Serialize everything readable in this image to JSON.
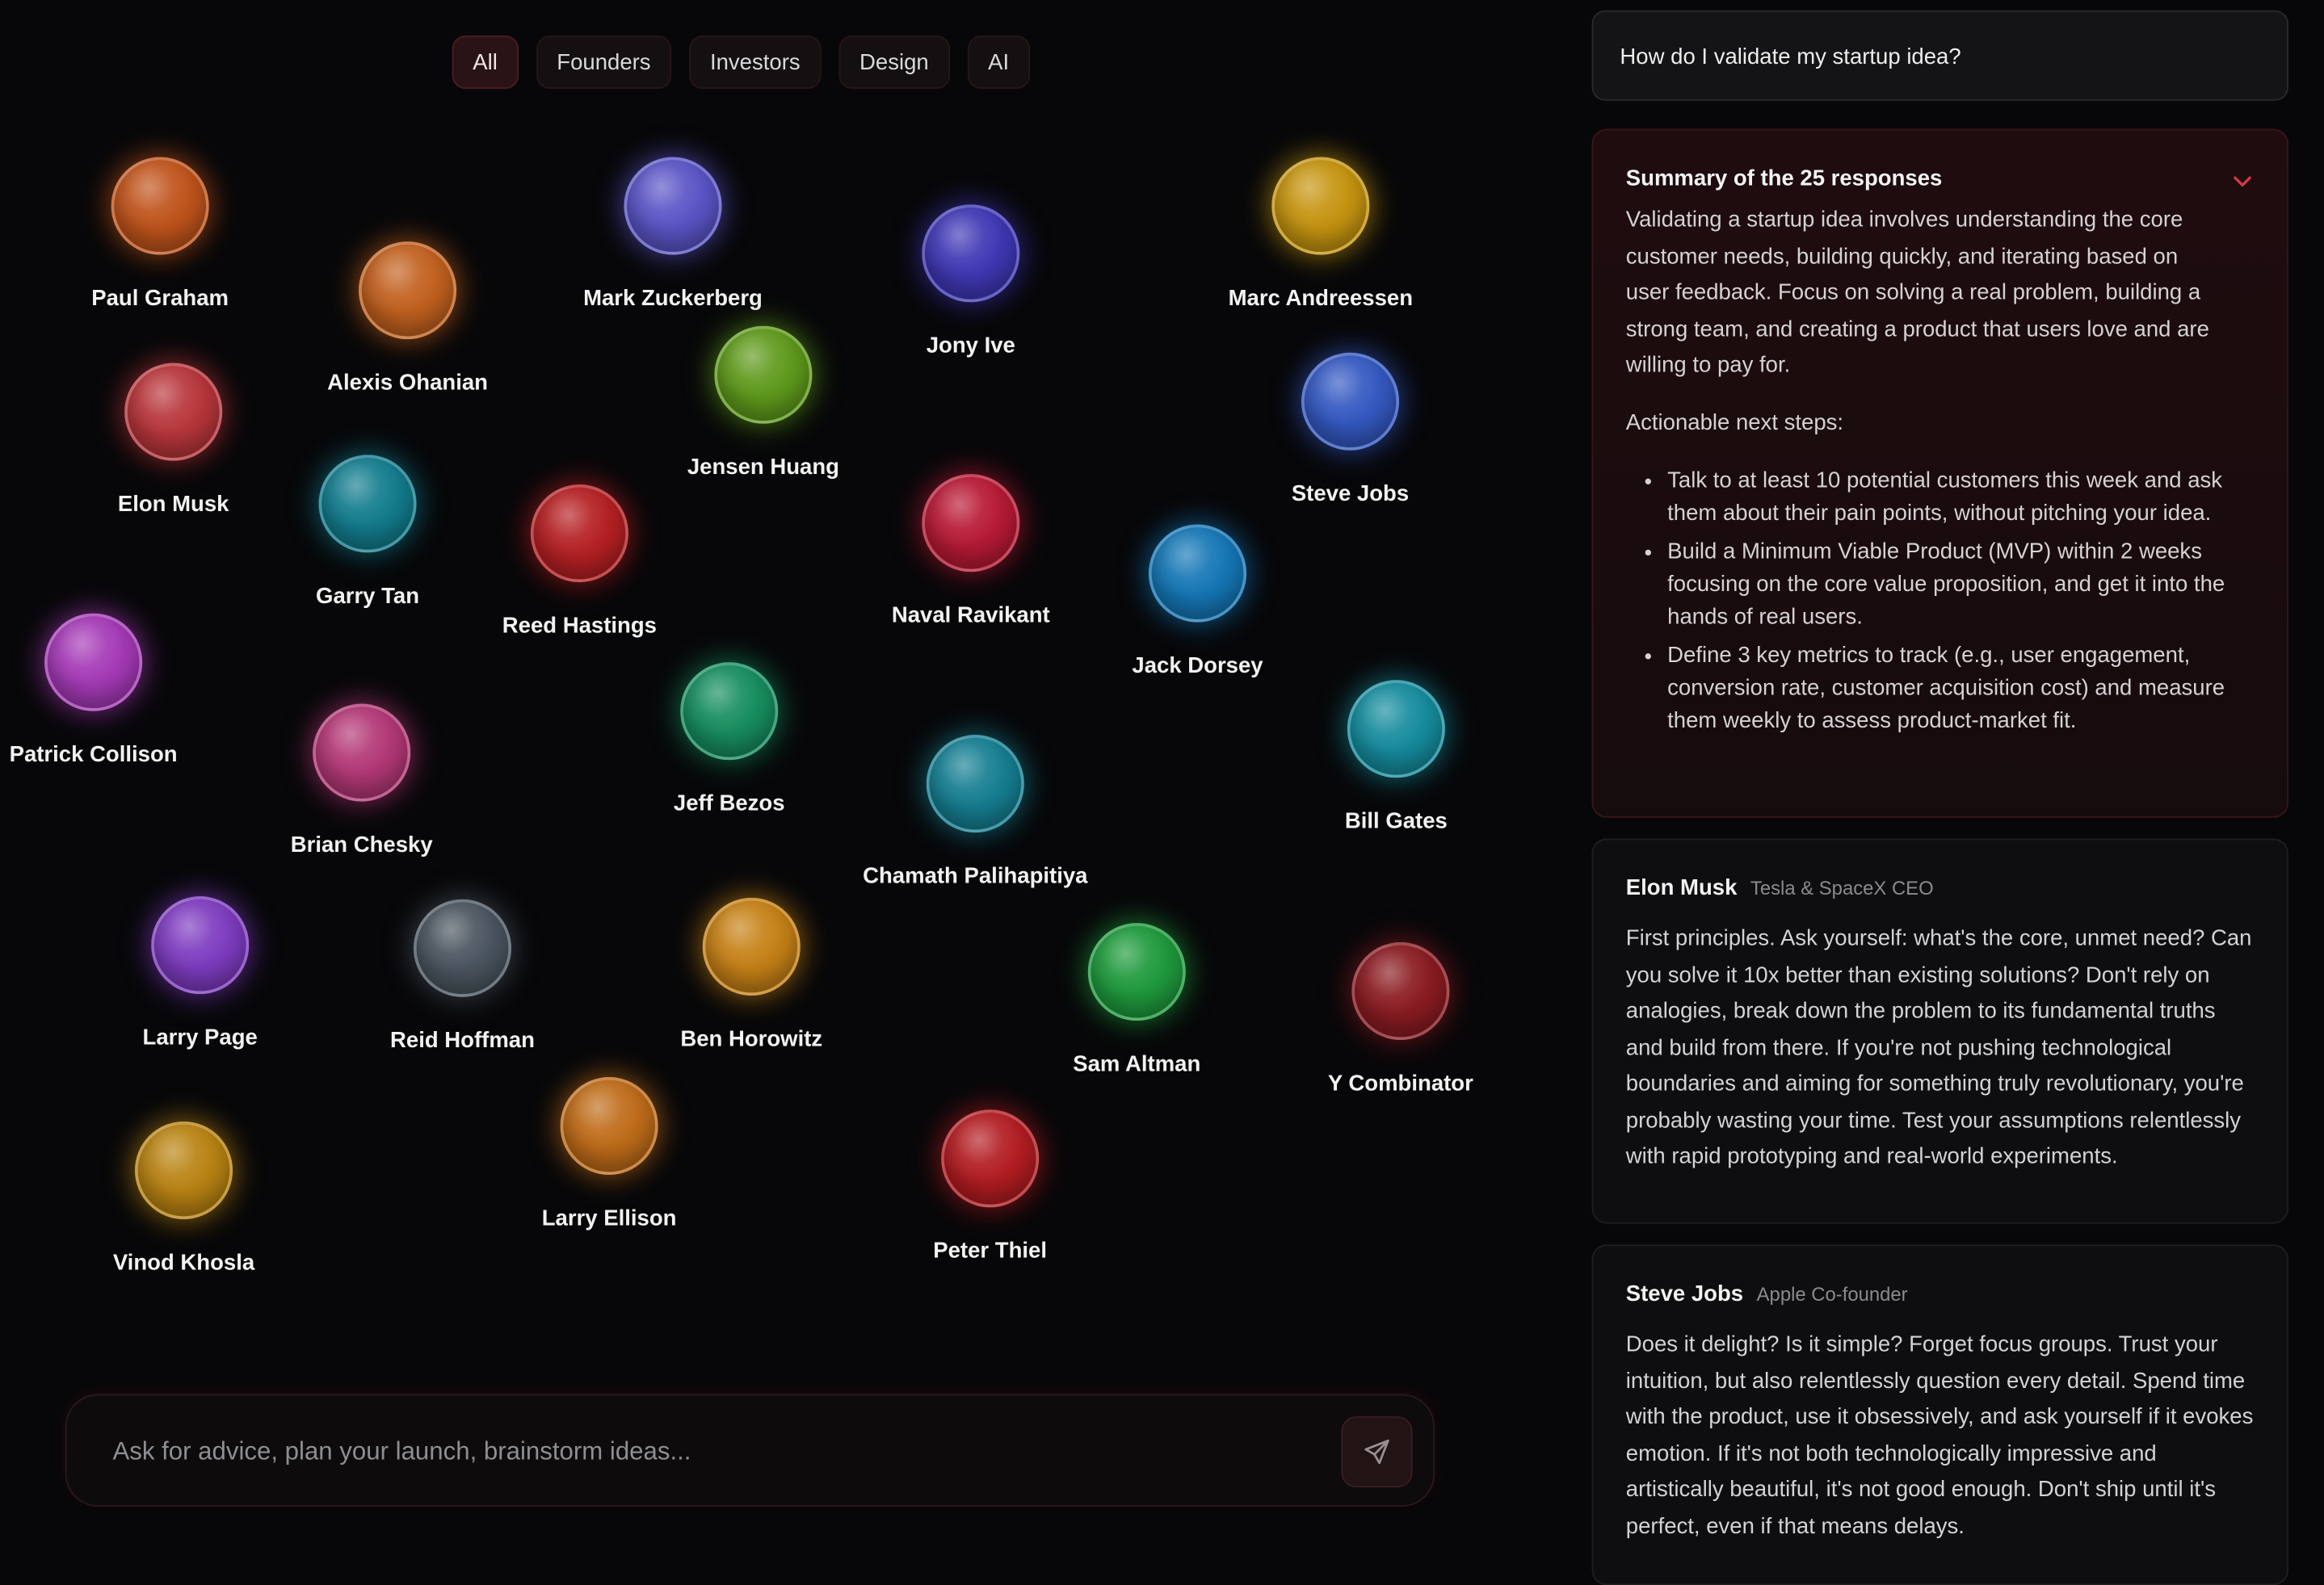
{
  "filters": [
    {
      "label": "All",
      "active": true
    },
    {
      "label": "Founders",
      "active": false
    },
    {
      "label": "Investors",
      "active": false
    },
    {
      "label": "Design",
      "active": false
    },
    {
      "label": "AI",
      "active": false
    }
  ],
  "agents": [
    {
      "name": "Paul Graham",
      "color": "#c0541c"
    },
    {
      "name": "Alexis Ohanian",
      "color": "#c2611f"
    },
    {
      "name": "Mark Zuckerberg",
      "color": "#5a55c6"
    },
    {
      "name": "Jony Ive",
      "color": "#3f38b5"
    },
    {
      "name": "Marc Andreessen",
      "color": "#c59410"
    },
    {
      "name": "Elon Musk",
      "color": "#b8363b"
    },
    {
      "name": "Jensen Huang",
      "color": "#5f9a1c"
    },
    {
      "name": "Steve Jobs",
      "color": "#3459c2"
    },
    {
      "name": "Garry Tan",
      "color": "#137d8e"
    },
    {
      "name": "Reed Hastings",
      "color": "#b52023"
    },
    {
      "name": "Naval Ravikant",
      "color": "#b81a35"
    },
    {
      "name": "Jack Dorsey",
      "color": "#1577b6"
    },
    {
      "name": "Patrick Collison",
      "color": "#a53ab7"
    },
    {
      "name": "Brian Chesky",
      "color": "#b33876"
    },
    {
      "name": "Jeff Bezos",
      "color": "#178e5f"
    },
    {
      "name": "Chamath Palihapitiya",
      "color": "#167f92"
    },
    {
      "name": "Bill Gates",
      "color": "#168c9e"
    },
    {
      "name": "Larry Page",
      "color": "#7e3cc0"
    },
    {
      "name": "Reid Hoffman",
      "color": "#4b5560"
    },
    {
      "name": "Ben Horowitz",
      "color": "#c68116"
    },
    {
      "name": "Sam Altman",
      "color": "#1f9a3d"
    },
    {
      "name": "Y Combinator",
      "color": "#8a1c22"
    },
    {
      "name": "Vinod Khosla",
      "color": "#b98313"
    },
    {
      "name": "Larry Ellison",
      "color": "#bf6c19"
    },
    {
      "name": "Peter Thiel",
      "color": "#b31d22"
    }
  ],
  "composer": {
    "placeholder": "Ask for advice, plan your launch, brainstorm ideas...",
    "send_icon": "send-icon"
  },
  "panel": {
    "question": "How do I validate my startup idea?",
    "summary": {
      "title": "Summary of the 25 responses",
      "collapse_icon": "chevron-down-icon",
      "body": "Validating a startup idea involves understanding the core customer needs, building quickly, and iterating based on user feedback. Focus on solving a real problem, building a strong team, and creating a product that users love and are willing to pay for.",
      "steps_heading": "Actionable next steps:",
      "steps": [
        "Talk to at least 10 potential customers this week and ask them about their pain points, without pitching your idea.",
        "Build a Minimum Viable Product (MVP) within 2 weeks focusing on the core value proposition, and get it into the hands of real users.",
        "Define 3 key metrics to track (e.g., user engagement, conversion rate, customer acquisition cost) and measure them weekly to assess product-market fit."
      ]
    },
    "responses": [
      {
        "name": "Elon Musk",
        "role": "Tesla & SpaceX CEO",
        "text": "First principles. Ask yourself: what's the core, unmet need? Can you solve it 10x better than existing solutions? Don't rely on analogies, break down the problem to its fundamental truths and build from there. If you're not pushing technological boundaries and aiming for something truly revolutionary, you're probably wasting your time. Test your assumptions relentlessly with rapid prototyping and real-world experiments."
      },
      {
        "name": "Steve Jobs",
        "role": "Apple Co-founder",
        "text": "Does it delight? Is it simple? Forget focus groups. Trust your intuition, but also relentlessly question every detail. Spend time with the product, use it obsessively, and ask yourself if it evokes emotion. If it's not both technologically impressive and artistically beautiful, it's not good enough. Don't ship until it's perfect, even if that means delays."
      }
    ]
  }
}
